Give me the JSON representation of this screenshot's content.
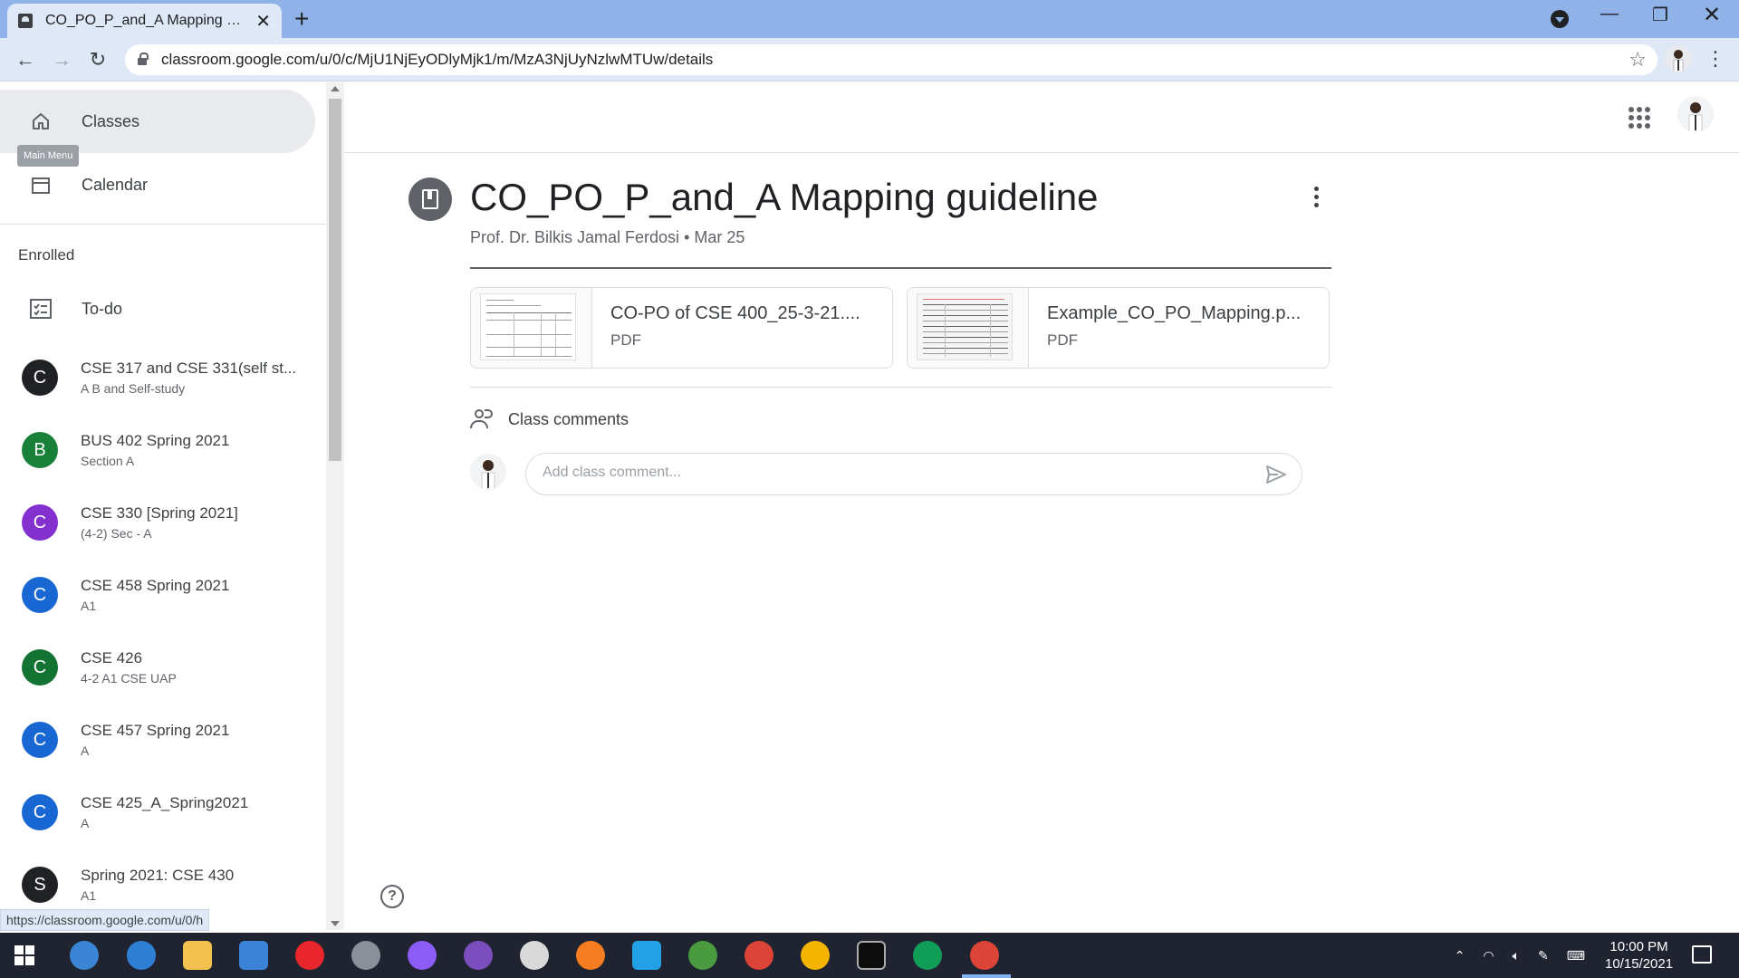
{
  "browser": {
    "tab_title": "CO_PO_P_and_A Mapping guideline",
    "url": "classroom.google.com/u/0/c/MjU1NjEyODlyMjk1/m/MzA3NjUyNzlwMTUw/details",
    "status_link": "https://classroom.google.com/u/0/h"
  },
  "sidebar": {
    "classes_label": "Classes",
    "calendar_label": "Calendar",
    "tooltip": "Main Menu",
    "enrolled_label": "Enrolled",
    "todo_label": "To-do",
    "classes": [
      {
        "letter": "C",
        "name": "CSE 317 and CSE 331(self st...",
        "section": "A B and Self-study",
        "color": "#202124"
      },
      {
        "letter": "B",
        "name": "BUS 402 Spring 2021",
        "section": "Section A",
        "color": "#188038"
      },
      {
        "letter": "C",
        "name": "CSE 330 [Spring 2021]",
        "section": "(4-2) Sec - A",
        "color": "#8430ce"
      },
      {
        "letter": "C",
        "name": "CSE 458 Spring 2021",
        "section": "A1",
        "color": "#1967d2"
      },
      {
        "letter": "C",
        "name": "CSE 426",
        "section": "4-2 A1 CSE UAP",
        "color": "#137333"
      },
      {
        "letter": "C",
        "name": "CSE 457 Spring 2021",
        "section": "A",
        "color": "#1967d2"
      },
      {
        "letter": "C",
        "name": "CSE 425_A_Spring2021",
        "section": "A",
        "color": "#1967d2"
      },
      {
        "letter": "S",
        "name": "Spring 2021: CSE 430",
        "section": "A1",
        "color": "#202124"
      }
    ]
  },
  "material": {
    "title": "CO_PO_P_and_A Mapping guideline",
    "author": "Prof. Dr. Bilkis Jamal Ferdosi",
    "date": "Mar 25",
    "separator": "•",
    "attachments": [
      {
        "name": "CO-PO of CSE 400_25-3-21....",
        "type": "PDF"
      },
      {
        "name": "Example_CO_PO_Mapping.p...",
        "type": "PDF"
      }
    ]
  },
  "comments": {
    "title": "Class comments",
    "placeholder": "Add class comment..."
  },
  "taskbar": {
    "time": "10:00 PM",
    "date": "10/15/2021"
  }
}
